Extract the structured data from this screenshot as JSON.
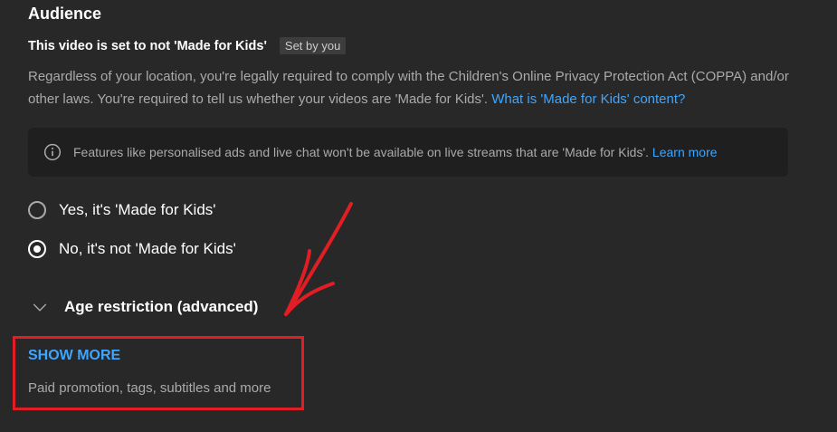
{
  "audience": {
    "title": "Audience",
    "status_text": "This video is set to not 'Made for Kids'",
    "status_badge": "Set by you",
    "description": "Regardless of your location, you're legally required to comply with the Children's Online Privacy Protection Act (COPPA) and/or other laws. You're required to tell us whether your videos are 'Made for Kids'. ",
    "description_link": "What is 'Made for Kids' content?",
    "info": {
      "icon": "info-icon",
      "text": "Features like personalised ads and live chat won't be available on live streams that are 'Made for Kids'. ",
      "link": "Learn more"
    },
    "options": [
      {
        "label": "Yes, it's 'Made for Kids'",
        "checked": false
      },
      {
        "label": "No, it's not 'Made for Kids'",
        "checked": true
      }
    ]
  },
  "age_restriction": {
    "label": "Age restriction (advanced)",
    "icon": "chevron-down-icon"
  },
  "show_more": {
    "label": "SHOW MORE",
    "subtitle": "Paid promotion, tags, subtitles and more"
  },
  "annotation": {
    "highlight_color": "#e01e24",
    "arrow_color": "#e01e24"
  }
}
